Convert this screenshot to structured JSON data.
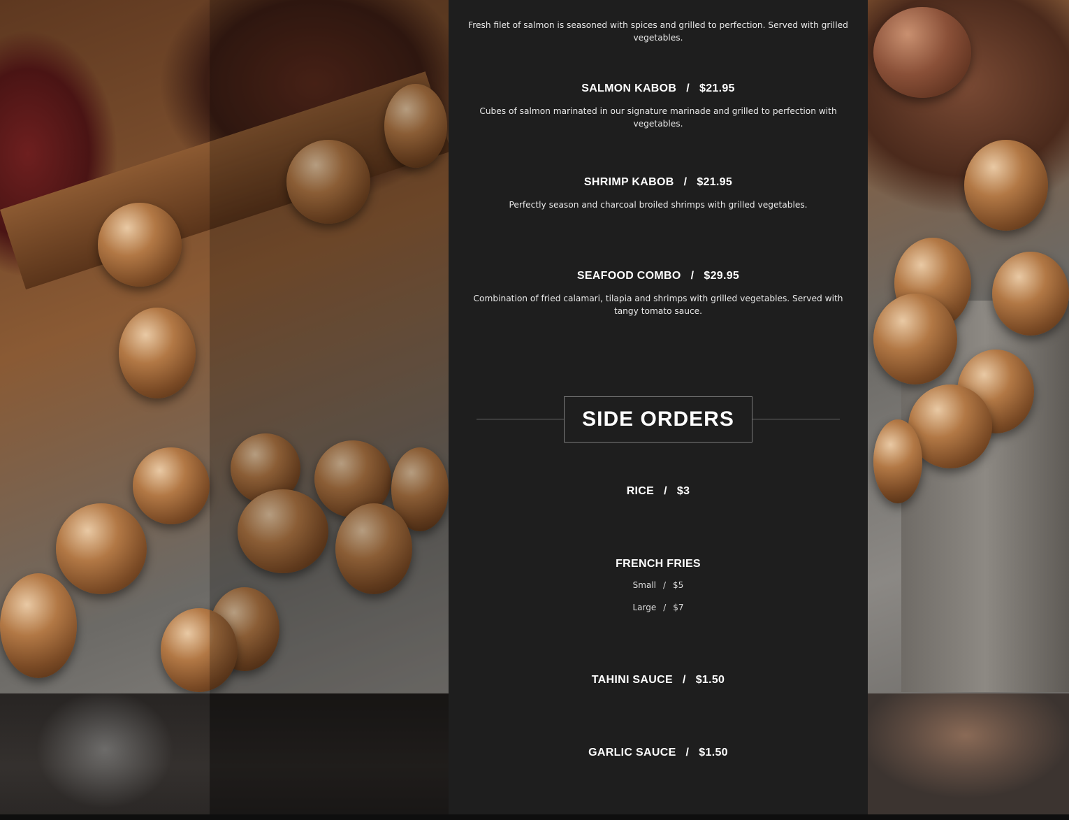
{
  "menu": {
    "items_top": [
      {
        "title": "",
        "price": "",
        "description": "Fresh filet of salmon is seasoned with spices and grilled to perfection. Served with grilled vegetables."
      },
      {
        "title": "SALMON KABOB",
        "price": "$21.95",
        "description": "Cubes of salmon marinated in our signature marinade and grilled to perfection with vegetables."
      },
      {
        "title": "SHRIMP KABOB",
        "price": "$21.95",
        "description": "Perfectly season and charcoal broiled shrimps with grilled vegetables."
      },
      {
        "title": "SEAFOOD COMBO",
        "price": "$29.95",
        "description": "Combination of fried calamari, tilapia and shrimps with grilled vegetables. Served with tangy tomato sauce."
      }
    ],
    "separator": "/",
    "side_orders": {
      "heading": "SIDE ORDERS",
      "items": [
        {
          "title": "RICE",
          "price": "$3"
        },
        {
          "title": "FRENCH FRIES",
          "sizes": [
            {
              "label": "Small",
              "price": "$5"
            },
            {
              "label": "Large",
              "price": "$7"
            }
          ]
        },
        {
          "title": "TAHINI SAUCE",
          "price": "$1.50"
        },
        {
          "title": "GARLIC SAUCE",
          "price": "$1.50"
        }
      ]
    }
  }
}
